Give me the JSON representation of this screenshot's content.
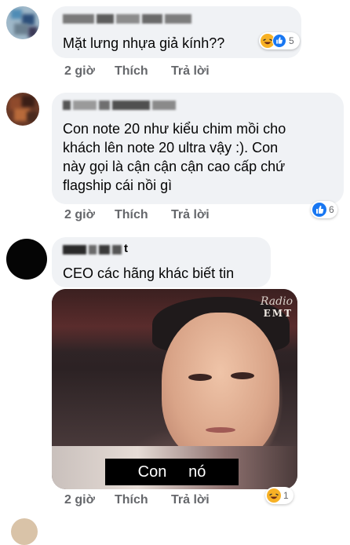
{
  "colors": {
    "bubble_bg": "#f0f2f5",
    "action_text": "#65676b",
    "like_blue": "#1877f2",
    "haha_yellow": "#f7b125"
  },
  "comments": [
    {
      "author": "",
      "text": "Mặt lưng nhựa giả kính??",
      "time": "2 giờ",
      "like_label": "Thích",
      "reply_label": "Trả lời",
      "reactions": [
        "haha-icon",
        "like-icon"
      ],
      "reaction_count": "5"
    },
    {
      "author": "",
      "text": "Con note 20 như kiểu chim mồi cho\nkhách lên note 20 ultra vậy :). Con\nnày gọi là cận cận cận cao cấp chứ\nflagship cái nồi gì",
      "time": "2 giờ",
      "like_label": "Thích",
      "reply_label": "Trả lời",
      "reactions": [
        "like-icon"
      ],
      "reaction_count": "6"
    },
    {
      "author": "t",
      "text": "CEO các hãng khác biết tin",
      "time": "2 giờ",
      "like_label": "Thích",
      "reply_label": "Trả lời",
      "reactions": [
        "haha-icon"
      ],
      "reaction_count": "1",
      "attachment": {
        "watermark_line1": "Radio",
        "watermark_line2": "EMT",
        "subtitle": "Con     nó"
      }
    }
  ]
}
